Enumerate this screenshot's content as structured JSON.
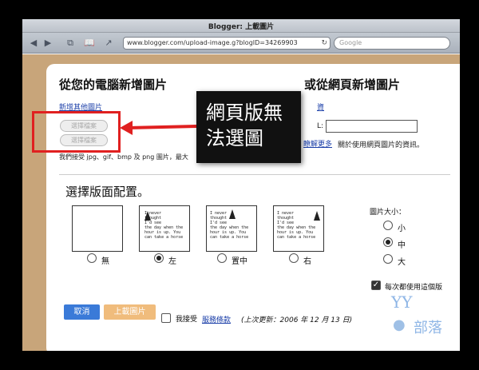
{
  "browser": {
    "title": "Blogger: 上載圖片",
    "url": "www.blogger.com/upload-image.g?blogID=34269903",
    "search_placeholder": "Google"
  },
  "upload_from_computer": {
    "heading": "從您的電腦新增圖片",
    "add_more_link": "新增其他圖片",
    "choose_file_1": "選擇檔案",
    "choose_file_2": "選擇檔案",
    "formats_note": "我們接受 jpg、gif、bmp 及 png 圖片，最大"
  },
  "upload_from_web": {
    "heading": "或從網頁新增圖片",
    "link_partial": "資",
    "url_label_partial": "L:",
    "learn_more_link": "瞭解更多",
    "learn_more_suffix": "關於使用網頁圖片的資訊。"
  },
  "callout": {
    "line1": "網頁版無",
    "line2": "法選圖"
  },
  "layout_section": {
    "heading": "選擇版面配置。",
    "options": [
      {
        "label": "無",
        "selected": false
      },
      {
        "label": "左",
        "selected": true
      },
      {
        "label": "置中",
        "selected": false
      },
      {
        "label": "右",
        "selected": false
      }
    ],
    "thumb_text": "I never\nthought\nI'd see\nthe day when the\nhour is up. You\ncan take a horse"
  },
  "image_size": {
    "heading": "圖片大小：",
    "options": [
      {
        "label": "小",
        "selected": false
      },
      {
        "label": "中",
        "selected": true
      },
      {
        "label": "大",
        "selected": false
      }
    ],
    "always_use": "每次都使用這個版"
  },
  "footer": {
    "cancel_label": "取消",
    "upload_label": "上載圖片",
    "accept_prefix": "我接受",
    "terms_link": "服務條款",
    "updated_note": "(上次更新：2006 年 12 月 13 日)"
  },
  "watermark": {
    "brand": "YY",
    "text": "部落"
  },
  "colors": {
    "page_bg": "#c8a57a",
    "highlight_red": "#e02020",
    "cancel_blue": "#3a7ad8",
    "upload_orange": "#f0bc7c"
  }
}
